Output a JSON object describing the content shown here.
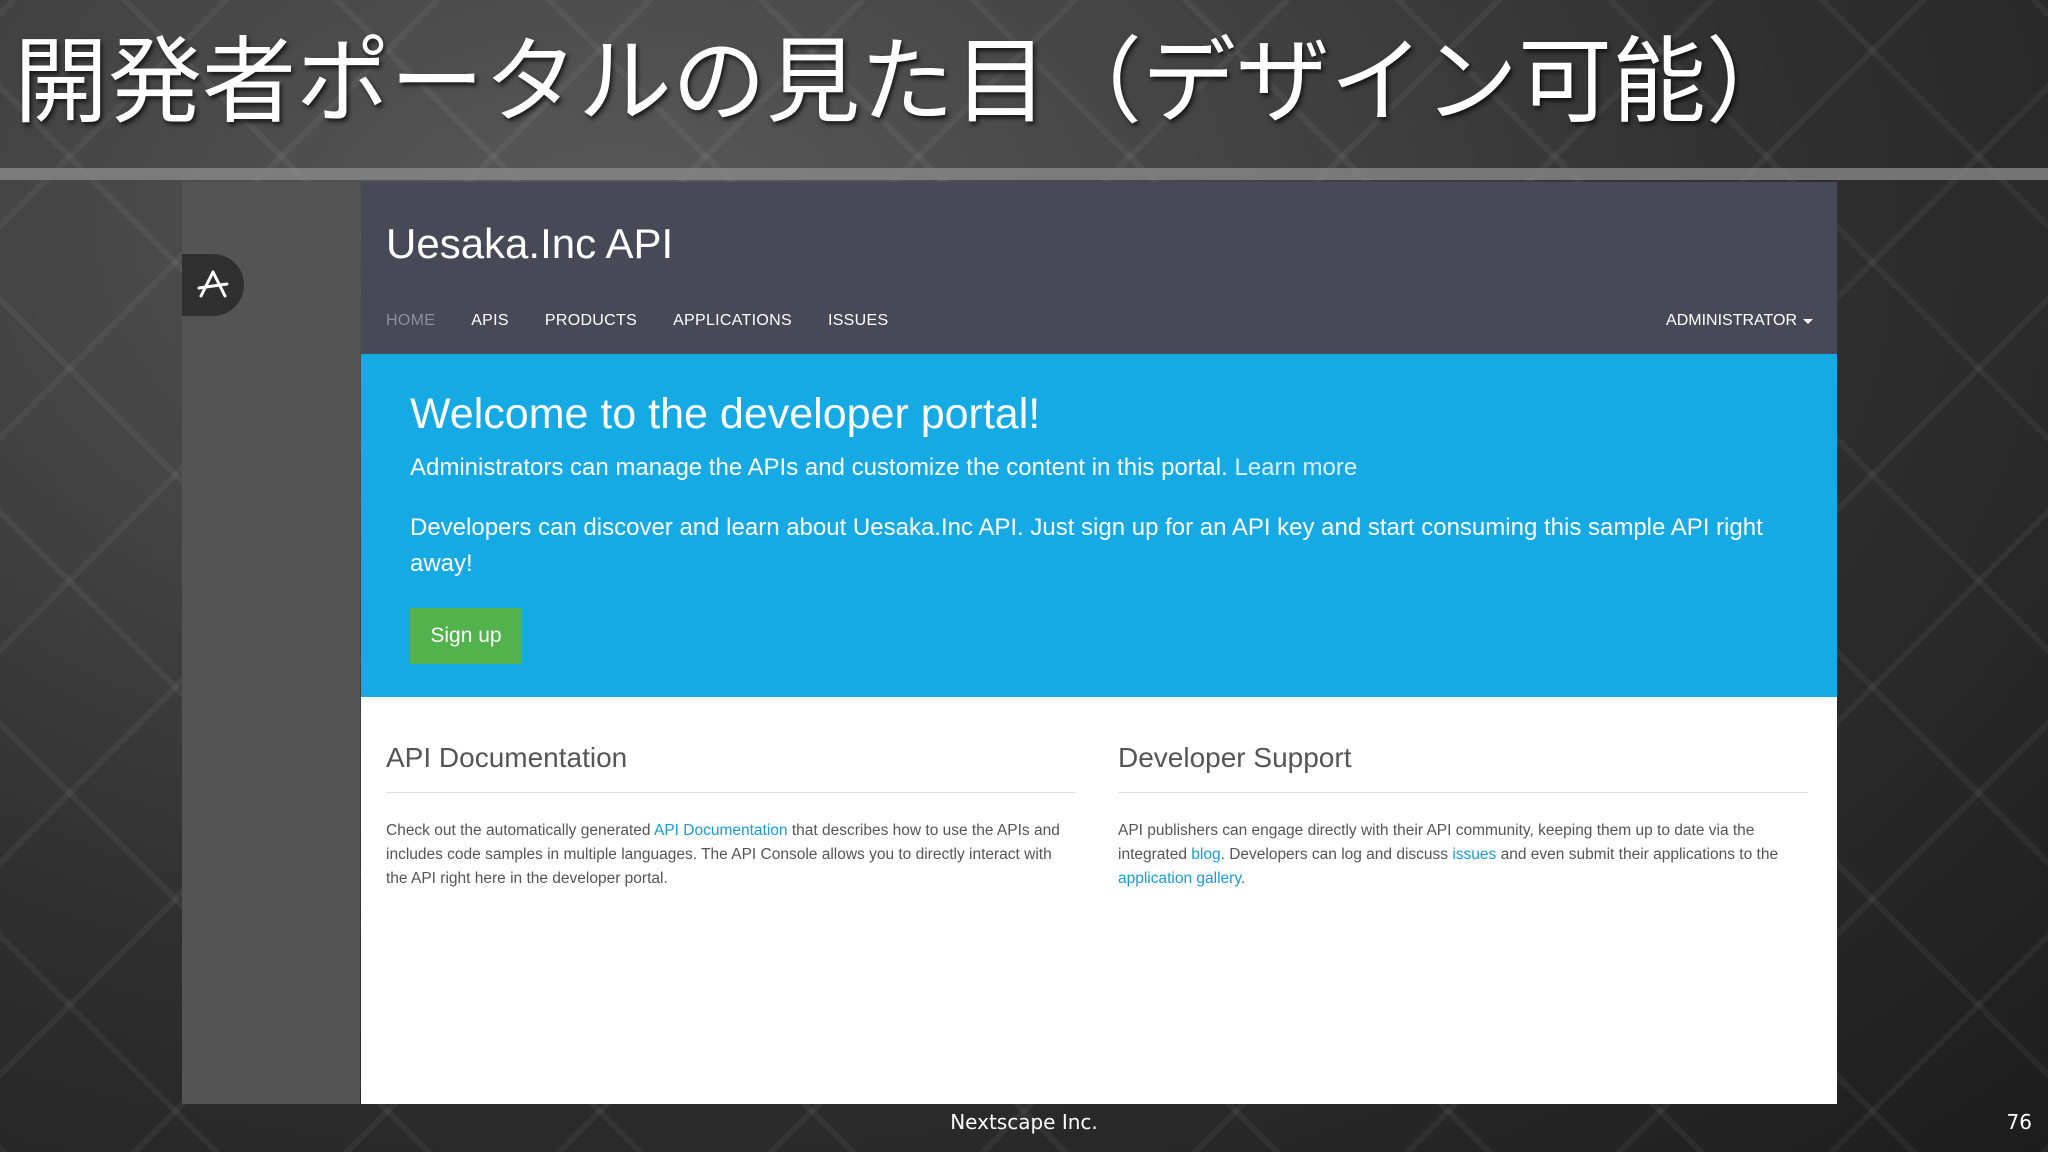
{
  "slide": {
    "title": "開発者ポータルの見た目（デザイン可能）",
    "footer_company": "Nextscape Inc.",
    "page_number": "76"
  },
  "portal": {
    "brand": "Uesaka.Inc API",
    "nav": {
      "items": [
        {
          "label": "HOME",
          "active": true
        },
        {
          "label": "APIS"
        },
        {
          "label": "PRODUCTS"
        },
        {
          "label": "APPLICATIONS"
        },
        {
          "label": "ISSUES"
        }
      ],
      "admin_label": "ADMINISTRATOR"
    },
    "hero": {
      "title": "Welcome to the developer portal!",
      "line1": "Administrators can manage the APIs and customize the content in this portal.",
      "learn_more": "Learn more",
      "line2": "Developers can discover and learn about Uesaka.Inc API. Just sign up for an API key and start consuming this sample API right away!",
      "signup_label": "Sign up"
    },
    "api_docs": {
      "title": "API Documentation",
      "text_before": "Check out the automatically generated",
      "link": "API Documentation",
      "text_after": "that describes how to use the APIs and includes code samples in multiple languages. The API Console allows you to directly interact with the API right here in the developer portal."
    },
    "dev_support": {
      "title": "Developer Support",
      "text1": "API publishers can engage directly with their API community, keeping them up to date via the integrated",
      "link_blog": "blog",
      "text2": ". Developers can log and discuss",
      "link_issues": "issues",
      "text3": "and even submit their applications to the",
      "link_gallery": "application gallery",
      "text4": "."
    },
    "colors": {
      "header_bg": "#474a56",
      "hero_bg": "#16aae5",
      "signup_bg": "#52b24b",
      "link": "#1a9bd7"
    },
    "icons": {
      "rail_logo": "app-store-icon",
      "admin_caret": "caret-down-icon"
    }
  }
}
